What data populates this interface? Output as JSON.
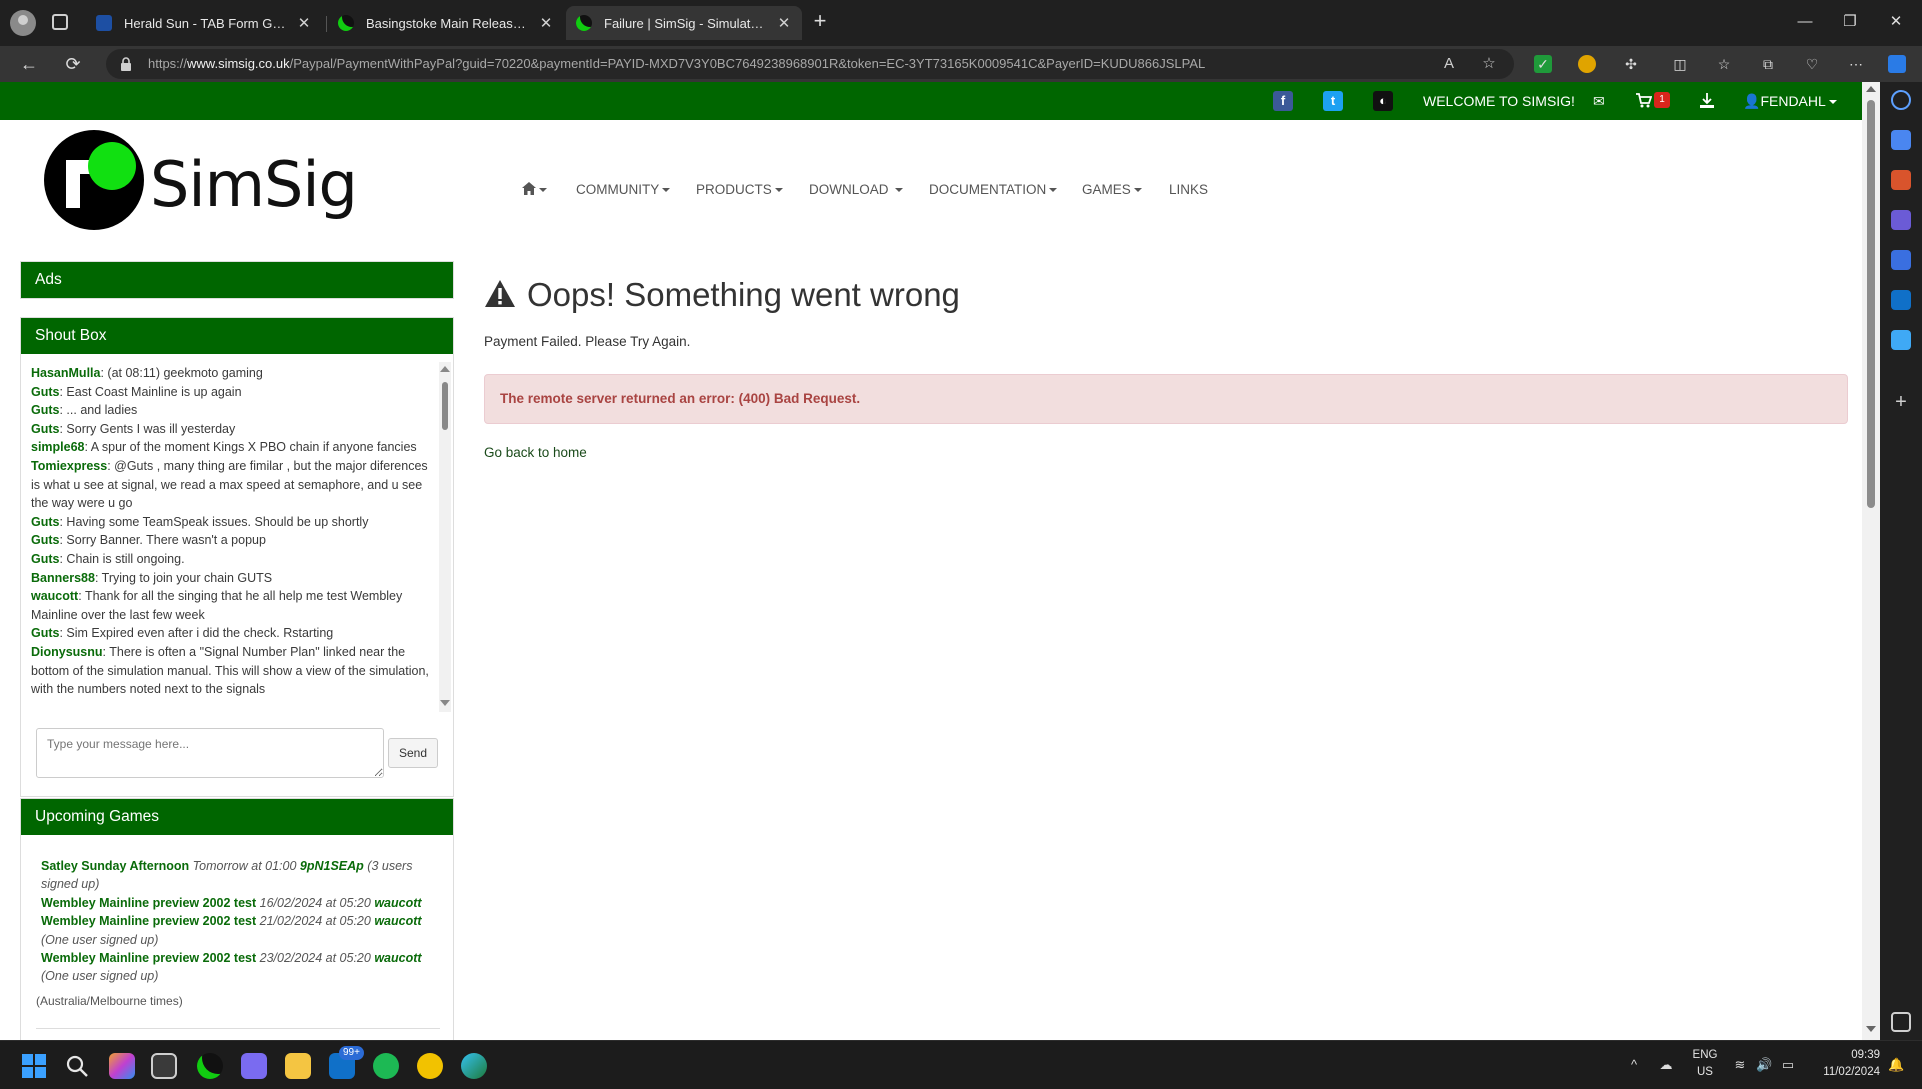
{
  "browser": {
    "tabs": [
      {
        "title": "Herald Sun - TAB Form Guide",
        "active": false
      },
      {
        "title": "Basingstoke Main Released! | Sim",
        "active": false
      },
      {
        "title": "Failure | SimSig - Simulator of Rail",
        "active": true
      }
    ],
    "url_prefix": "https://",
    "url_domain": "www.simsig.co.uk",
    "url_path": "/Paypal/PaymentWithPayPal?guid=70220&paymentId=PAYID-MXD7V3Y0BC7649238968901R&token=EC-3YT73165K0009541C&PayerID=KUDU866JSLPAL"
  },
  "topbar": {
    "welcome": "WELCOME TO SIMSIG!",
    "cart_count": "1",
    "user": "FENDAHL"
  },
  "logo": {
    "word": "SimSig"
  },
  "nav": {
    "community": "COMMUNITY",
    "products": "PRODUCTS",
    "download": "DOWNLOAD",
    "documentation": "DOCUMENTATION",
    "games": "GAMES",
    "links": "LINKS"
  },
  "ads": {
    "title": "Ads"
  },
  "shoutbox": {
    "title": "Shout Box",
    "messages": [
      {
        "user": "HasanMulla",
        "text": ": (at 08:11) geekmoto gaming"
      },
      {
        "user": "Guts",
        "text": ": East Coast Mainline is up again"
      },
      {
        "user": "Guts",
        "text": ": ... and ladies"
      },
      {
        "user": "Guts",
        "text": ": Sorry Gents I was ill yesterday"
      },
      {
        "user": "simple68",
        "text": ": A spur of the moment Kings X PBO chain if anyone fancies"
      },
      {
        "user": "Tomiexpress",
        "text": ": @Guts , many thing are fimilar , but the major diferences is what u see at signal, we read a max speed at semaphore, and u see the way were u go"
      },
      {
        "user": "Guts",
        "text": ": Having some TeamSpeak issues. Should be up shortly"
      },
      {
        "user": "Guts",
        "text": ": Sorry Banner. There wasn't a popup"
      },
      {
        "user": "Guts",
        "text": ": Chain is still ongoing."
      },
      {
        "user": "Banners88",
        "text": ": Trying to join your chain GUTS"
      },
      {
        "user": "waucott",
        "text": ": Thank for all the singing that he all help me test Wembley Mainline over the last few week"
      },
      {
        "user": "Guts",
        "text": ": Sim Expired even after i did the check. Rstarting"
      },
      {
        "user": "Dionysusnu",
        "text": ": There is often a \"Signal Number Plan\" linked near the bottom of the simulation manual. This will show a view of the simulation, with the numbers noted next to the signals"
      }
    ],
    "placeholder": "Type your message here...",
    "send": "Send"
  },
  "games": {
    "title": "Upcoming Games",
    "items": [
      {
        "name": "Satley Sunday Afternoon",
        "time": "Tomorrow at 01:00",
        "host": "9pN1SEAp",
        "note": "(3 users signed up)"
      },
      {
        "name": "Wembley Mainline preview 2002 test",
        "time": "16/02/2024 at 05:20",
        "host": "waucott",
        "note": ""
      },
      {
        "name": "Wembley Mainline preview 2002 test",
        "time": "21/02/2024 at 05:20",
        "host": "waucott",
        "note": "(One user signed up)"
      },
      {
        "name": "Wembley Mainline preview 2002 test",
        "time": "23/02/2024 at 05:20",
        "host": "waucott",
        "note": "(One user signed up)"
      }
    ],
    "timezone": "(Australia/Melbourne times)"
  },
  "main": {
    "title": "Oops! Something went wrong",
    "message": "Payment Failed. Please Try Again.",
    "error": "The remote server returned an error: (400) Bad Request.",
    "home_link": "Go back to home"
  },
  "taskbar": {
    "mail_badge": "99+",
    "lang_top": "ENG",
    "lang_bottom": "US",
    "time": "09:39",
    "date": "11/02/2024"
  },
  "colors": {
    "brand_green": "#006600",
    "logo_green": "#11e011",
    "alert_bg": "#f2dede",
    "alert_text": "#a94442"
  }
}
